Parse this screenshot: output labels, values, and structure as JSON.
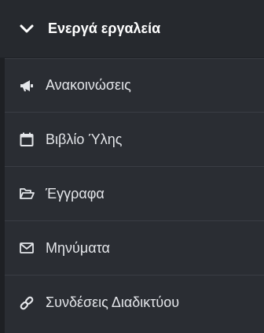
{
  "header": {
    "title": "Ενεργά εργαλεία",
    "icon": "chevron-down-icon"
  },
  "items": [
    {
      "label": "Ανακοινώσεις",
      "icon": "megaphone-icon"
    },
    {
      "label": "Βιβλίο Ύλης",
      "icon": "calendar-icon"
    },
    {
      "label": "Έγγραφα",
      "icon": "folder-open-icon"
    },
    {
      "label": "Μηνύματα",
      "icon": "envelope-icon"
    },
    {
      "label": "Συνδέσεις Διαδικτύου",
      "icon": "link-icon"
    }
  ],
  "colors": {
    "background": "#2a2d33",
    "header": "#26292e",
    "text": "#e4e6ea",
    "divider": "#3a3d44"
  }
}
